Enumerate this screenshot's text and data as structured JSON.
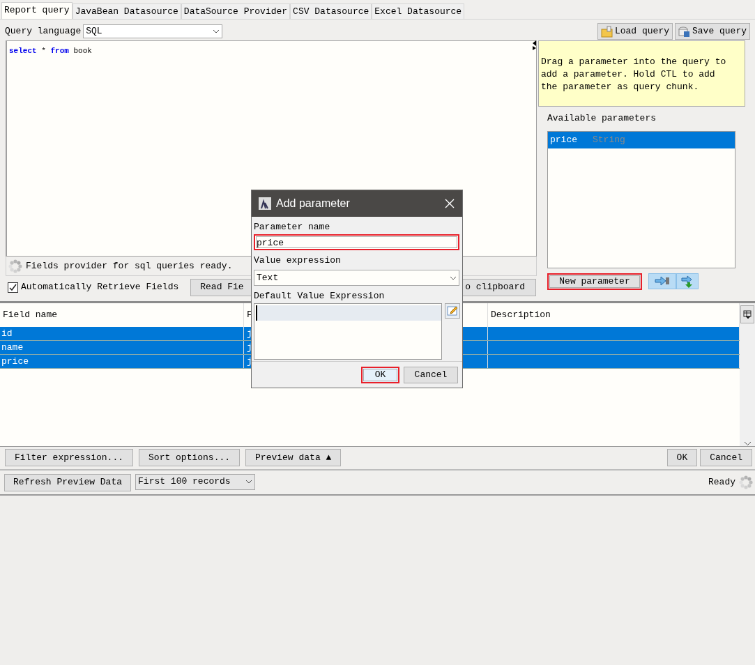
{
  "tabs": [
    {
      "label": "Report query",
      "selected": true
    },
    {
      "label": "JavaBean Datasource",
      "selected": false
    },
    {
      "label": "DataSource Provider",
      "selected": false
    },
    {
      "label": "CSV Datasource",
      "selected": false
    },
    {
      "label": "Excel Datasource",
      "selected": false
    }
  ],
  "query_language": {
    "label": "Query language",
    "value": "SQL"
  },
  "toolbar_buttons": [
    {
      "label": "Load query",
      "kind": "load"
    },
    {
      "label": "Save query",
      "kind": "save"
    }
  ],
  "query_text": [
    {
      "text": "select",
      "kind": "keyword"
    },
    {
      "text": "*",
      "kind": "plain"
    },
    {
      "text": "from",
      "kind": "keyword"
    },
    {
      "text": "book",
      "kind": "plain"
    }
  ],
  "status_message": "Fields provider for sql queries ready.",
  "auto_retrieve": {
    "label": "Automatically Retrieve Fields",
    "checked": true
  },
  "read_fields_button": "Read Fie",
  "clipboard_button": "o clipboard",
  "hint": "Drag a parameter into the query to add a parameter. Hold CTL to add the parameter as query chunk.",
  "parameters": {
    "title": "Available parameters",
    "items": [
      {
        "name": "price",
        "type": "String",
        "selected": true
      }
    ]
  },
  "new_parameter_button": {
    "label": "New parameter",
    "highlighted": true
  },
  "fields_table": {
    "columns": [
      "Field name",
      "F",
      "Description"
    ],
    "rows": [
      {
        "name": "id",
        "column_2": "j",
        "selected": true
      },
      {
        "name": "name",
        "column_2": "j",
        "selected": true
      },
      {
        "name": "price",
        "column_2": "j",
        "selected": true
      }
    ]
  },
  "bottom_buttons": {
    "left": [
      "Filter expression...",
      "Sort options...",
      "Preview data ▲"
    ],
    "right": [
      "OK",
      "Cancel"
    ]
  },
  "preview_toolbar": {
    "refresh": "Refresh Preview Data",
    "limit": "First 100 records",
    "status": "Ready"
  },
  "dialog": {
    "title": "Add parameter",
    "name_label": "Parameter name",
    "name_value": "price",
    "name_highlighted": true,
    "value_label": "Value expression",
    "value_type": "Text",
    "default_label": "Default Value Expression",
    "buttons": [
      {
        "label": "OK",
        "highlighted": true
      },
      {
        "label": "Cancel",
        "highlighted": false
      }
    ]
  }
}
